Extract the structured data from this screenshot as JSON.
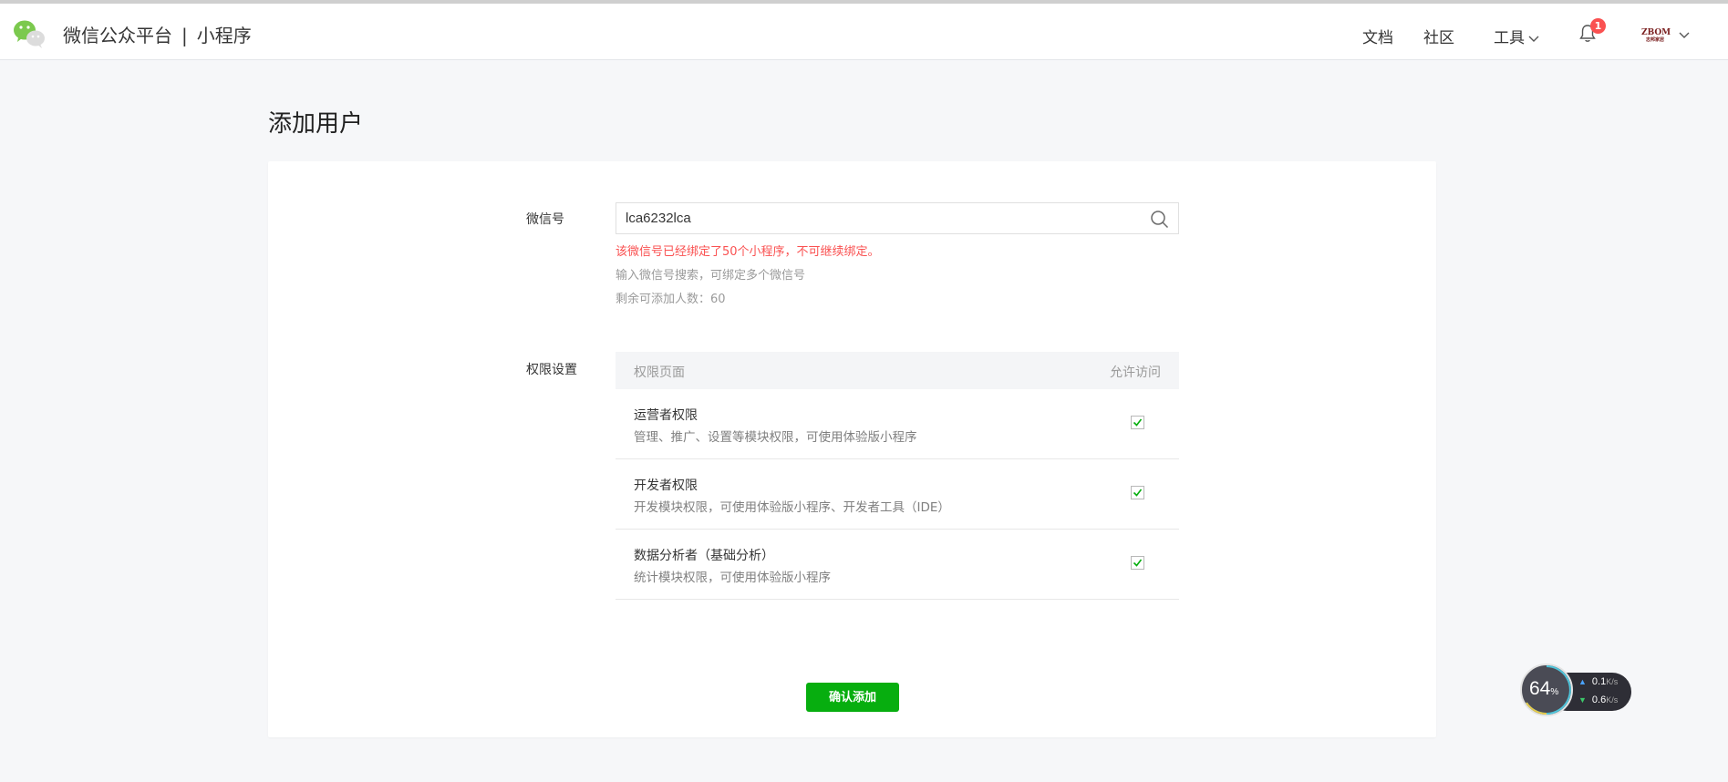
{
  "header": {
    "brand_left": "微信公众平台",
    "brand_separator": "|",
    "brand_right": "小程序",
    "nav": {
      "docs": "文档",
      "community": "社区",
      "tools": "工具"
    },
    "notification_count": "1",
    "avatar_text": "ZBOM",
    "avatar_subtext": "志邦家居"
  },
  "page": {
    "title": "添加用户"
  },
  "form": {
    "wechat_label": "微信号",
    "wechat_value": "lca6232lca",
    "error_message": "该微信号已经绑定了50个小程序，不可继续绑定。",
    "hint": "输入微信号搜索，可绑定多个微信号",
    "remaining": "剩余可添加人数：60",
    "permissions_label": "权限设置",
    "permissions_table": {
      "header_left": "权限页面",
      "header_right": "允许访问",
      "rows": [
        {
          "title": "运营者权限",
          "desc": "管理、推广、设置等模块权限，可使用体验版小程序",
          "checked": true
        },
        {
          "title": "开发者权限",
          "desc": "开发模块权限，可使用体验版小程序、开发者工具（IDE）",
          "checked": true
        },
        {
          "title": "数据分析者（基础分析）",
          "desc": "统计模块权限，可使用体验版小程序",
          "checked": true
        }
      ]
    },
    "confirm_button": "确认添加"
  },
  "net_monitor": {
    "percent": "64",
    "percent_unit": "%",
    "upload": "0.1",
    "download": "0.6",
    "unit": "K/s"
  },
  "colors": {
    "brand_green": "#07ae0f",
    "error_red": "#fa5151",
    "badge_red": "#fa5151"
  }
}
